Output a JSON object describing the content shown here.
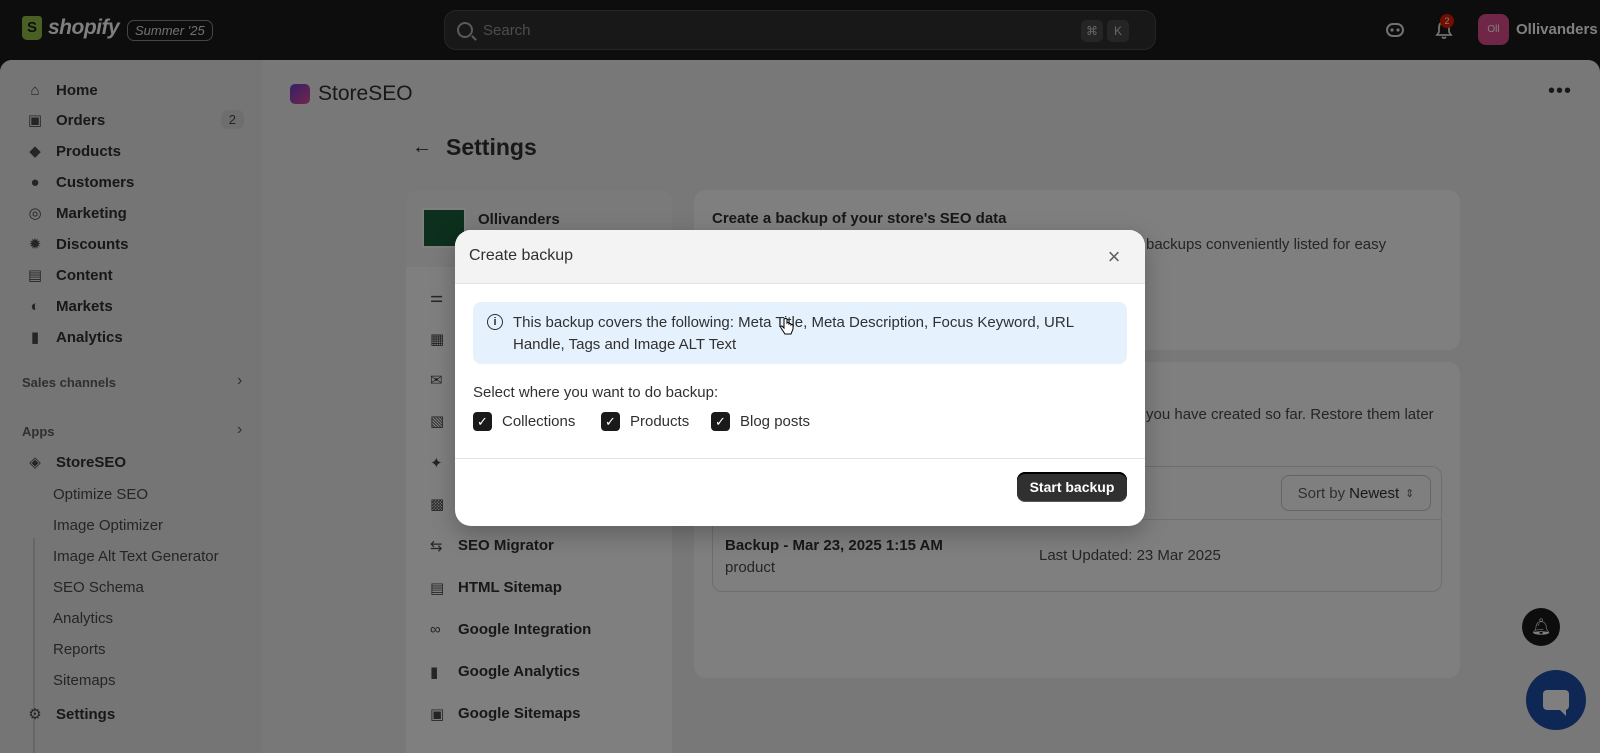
{
  "topbar": {
    "brand": "shopify",
    "season_badge": "Summer '25",
    "search_placeholder": "Search",
    "shortcut_cmd": "⌘",
    "shortcut_key": "K",
    "notification_count": "2",
    "store_avatar": "Oll",
    "store_name": "Ollivanders"
  },
  "sidebar": {
    "items": [
      {
        "label": "Home",
        "icon": "home-icon"
      },
      {
        "label": "Orders",
        "icon": "orders-icon",
        "badge": "2"
      },
      {
        "label": "Products",
        "icon": "tag-icon"
      },
      {
        "label": "Customers",
        "icon": "person-icon"
      },
      {
        "label": "Marketing",
        "icon": "target-icon"
      },
      {
        "label": "Discounts",
        "icon": "discount-icon"
      },
      {
        "label": "Content",
        "icon": "content-icon"
      },
      {
        "label": "Markets",
        "icon": "globe-icon"
      },
      {
        "label": "Analytics",
        "icon": "bar-chart-icon"
      }
    ],
    "sales_channels": "Sales channels",
    "apps": "Apps",
    "app_name": "StoreSEO",
    "sub_items": [
      "Optimize SEO",
      "Image Optimizer",
      "Image Alt Text Generator",
      "SEO Schema",
      "Analytics",
      "Reports",
      "Sitemaps"
    ],
    "settings": "Settings"
  },
  "app": {
    "title": "StoreSEO",
    "page_title": "Settings"
  },
  "settings_menu": {
    "store_name": "Ollivanders",
    "items": [
      "SEO Migrator",
      "HTML Sitemap",
      "Google Integration",
      "Google Analytics",
      "Google Sitemaps"
    ]
  },
  "backup_card": {
    "heading": "Create a backup of your store's SEO data",
    "text_fragment": "backups conveniently listed for easy"
  },
  "list_card": {
    "text_fragment": "you have created so far. Restore them later",
    "sort_label": "Sort by",
    "sort_value": "Newest",
    "row": {
      "name": "Backup - Mar 23, 2025 1:15 AM",
      "type": "product",
      "updated": "Last Updated: 23 Mar 2025"
    }
  },
  "modal": {
    "title": "Create backup",
    "info_text": "This backup covers the following: Meta Title, Meta Description, Focus Keyword, URL Handle, Tags and Image ALT Text",
    "select_label": "Select where you want to do backup:",
    "options": [
      {
        "label": "Collections",
        "checked": true
      },
      {
        "label": "Products",
        "checked": true
      },
      {
        "label": "Blog posts",
        "checked": true
      }
    ],
    "start_button": "Start backup"
  }
}
